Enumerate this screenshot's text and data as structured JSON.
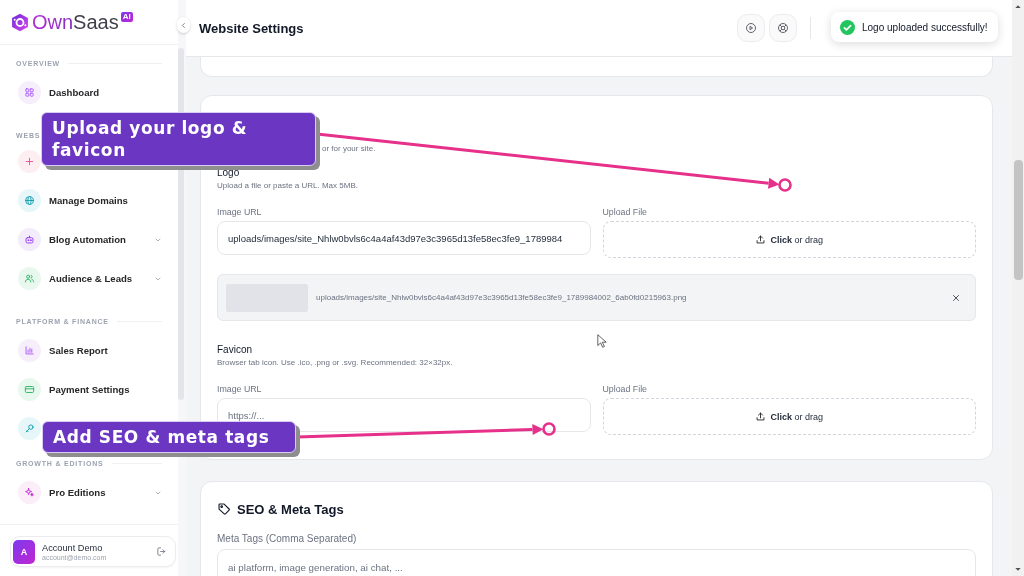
{
  "sidebar": {
    "brand": {
      "name": "OwnSaas",
      "badge": "AI"
    },
    "sections": [
      {
        "label": "OVERVIEW",
        "items": [
          {
            "label": "Dashboard",
            "selected": false
          }
        ]
      },
      {
        "label": "WEBS",
        "items": [
          {
            "selected": false
          },
          {
            "label": "Manage Domains",
            "selected": false
          },
          {
            "label": "Blog Automation",
            "selected": false,
            "expanded": false
          },
          {
            "label": "Audience & Leads",
            "selected": false,
            "expanded": false
          }
        ]
      },
      {
        "label": "PLATFORM & FINANCE",
        "items": [
          {
            "label": "Sales Report",
            "selected": false
          },
          {
            "label": "Payment Settings",
            "selected": false
          },
          {
            "selected": false
          }
        ]
      },
      {
        "label": "GROWTH & EDITIONS",
        "items": [
          {
            "label": "Pro Editions",
            "selected": false,
            "expanded": false
          }
        ]
      }
    ],
    "account": {
      "initial": "A",
      "name": "Account Demo",
      "email": "account@demo.com"
    }
  },
  "header": {
    "title": "Website Settings"
  },
  "toast": {
    "message": "Logo uploaded successfully!"
  },
  "branding": {
    "subtitle": "or for your site.",
    "logo": {
      "title": "Logo",
      "hint": "Upload a file or paste a URL. Max 5MB.",
      "image_url": {
        "label": "Image URL",
        "value": "uploads/images/site_Nhlw0bvls6c4a4af43d97e3c3965d13fe58ec3fe9_1789984"
      },
      "upload": {
        "label": "Upload File",
        "text": "**Click** or drag"
      },
      "preview": {
        "filename": "uploads/images/site_Nhlw0bvls6c4a4af43d97e3c3965d13fe58ec3fe9_1789984002_6ab0fd0215963.png"
      }
    },
    "favicon": {
      "title": "Favicon",
      "hint": "Browser tab icon. Use .ico, .png or .svg. Recommended: 32×32px.",
      "image_url": {
        "label": "Image URL",
        "placeholder": "https://..."
      },
      "upload": {
        "label": "Upload File",
        "text": "**Click** or drag"
      }
    }
  },
  "seo": {
    "title": "SEO & Meta Tags",
    "meta_tags": {
      "label": "Meta Tags (Comma Separated)",
      "placeholder": "ai platform, image generation, ai chat, ..."
    }
  },
  "annotations": [
    {
      "text": "Upload your logo & favicon"
    },
    {
      "text": "Add SEO & meta tags"
    }
  ]
}
